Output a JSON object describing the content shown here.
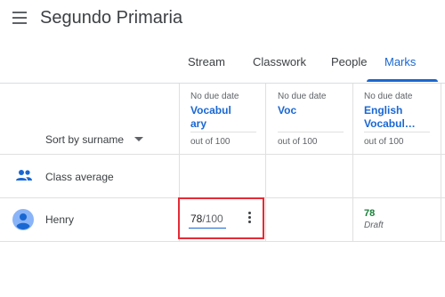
{
  "header": {
    "title": "Segundo Primaria"
  },
  "tabs": [
    {
      "label": "Stream"
    },
    {
      "label": "Classwork"
    },
    {
      "label": "People"
    },
    {
      "label": "Marks",
      "active": true
    }
  ],
  "sort": {
    "label": "Sort by surname"
  },
  "assignments": [
    {
      "due": "No due date",
      "title": "Vocabulary",
      "out_of": "out of 100"
    },
    {
      "due": "No due date",
      "title": "Voc",
      "out_of": "out of 100"
    },
    {
      "due": "No due date",
      "title": "English Vocabul…",
      "out_of": "out of 100"
    }
  ],
  "rows": {
    "class_average": {
      "label": "Class average"
    },
    "student": {
      "name": "Henry",
      "grade_value": "78",
      "grade_denominator": "/100",
      "assignment3_score": "78",
      "assignment3_status": "Draft"
    }
  },
  "colors": {
    "accent": "#1967d2",
    "highlight": "#e52b36",
    "draft_green": "#188038"
  },
  "icons": {
    "menu": "menu-icon",
    "caret": "caret-down-icon",
    "group": "group-icon",
    "avatar": "person-avatar-icon",
    "more": "more-vert-icon"
  }
}
